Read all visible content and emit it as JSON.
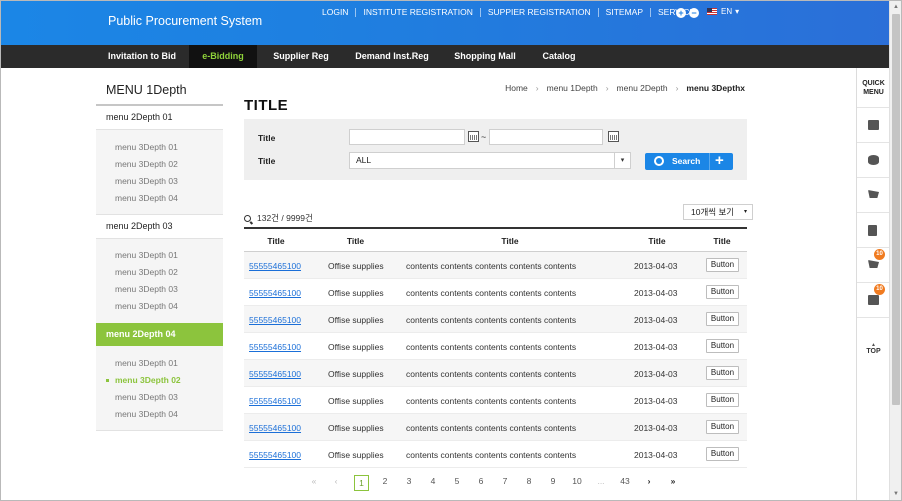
{
  "header": {
    "site_title": "Public Procurement System",
    "util_links": [
      "LOGIN",
      "INSTITUTE REGISTRATION",
      "SUPPIER REGISTRATION",
      "SITEMAP",
      "SERVICE"
    ],
    "zoom_in": "+",
    "zoom_out": "−",
    "language": "EN",
    "language_arrow": "▾"
  },
  "nav": {
    "items": [
      "Invitation to Bid",
      "e-Bidding",
      "Supplier Reg",
      "Demand Inst.Reg",
      "Shopping Mall",
      "Catalog"
    ],
    "active": "e-Bidding",
    "active_color": "#8fd33a"
  },
  "left_menu": {
    "title": "MENU 1Depth",
    "sections": [
      {
        "label": "menu 2Depth 01",
        "items": [
          "menu 3Depth 01",
          "menu 3Depth 02",
          "menu 3Depth 03",
          "menu 3Depth 04"
        ]
      },
      {
        "label": "menu 2Depth 03",
        "items": [
          "menu 3Depth 01",
          "menu 3Depth 02",
          "menu 3Depth 03",
          "menu 3Depth 04"
        ]
      },
      {
        "label": "menu 2Depth 04",
        "items": [
          "menu 3Depth 01",
          "menu 3Depth 02",
          "menu 3Depth 03",
          "menu 3Depth 04"
        ]
      }
    ],
    "active_color": "#8cc43d"
  },
  "breadcrumb": [
    "Home",
    "menu 1Depth",
    "menu 2Depth",
    "menu 3Depthx"
  ],
  "breadcrumb_sep": "›",
  "page_title": "TITLE",
  "search": {
    "label1": "Title",
    "label2": "Title",
    "date_tilde": "~",
    "select_value": "ALL",
    "select_arrow": "▾",
    "search_button": "Search",
    "add_button": "+"
  },
  "results": {
    "count_text": "132건 / 9999건",
    "per_page": "10개씩 보기",
    "per_page_arrow": "▾"
  },
  "table": {
    "headers": [
      "Title",
      "Title",
      "Title",
      "Title",
      "Title"
    ],
    "rows": [
      {
        "id": "55555465100",
        "name": "Offise supplies",
        "content": "contents contents contents contents contents",
        "date": "2013-04-03",
        "button": "Button"
      },
      {
        "id": "55555465100",
        "name": "Offise supplies",
        "content": "contents contents contents contents contents",
        "date": "2013-04-03",
        "button": "Button"
      },
      {
        "id": "55555465100",
        "name": "Offise supplies",
        "content": "contents contents contents contents contents",
        "date": "2013-04-03",
        "button": "Button"
      },
      {
        "id": "55555465100",
        "name": "Offise supplies",
        "content": "contents contents contents contents contents",
        "date": "2013-04-03",
        "button": "Button"
      },
      {
        "id": "55555465100",
        "name": "Offise supplies",
        "content": "contents contents contents contents contents",
        "date": "2013-04-03",
        "button": "Button"
      },
      {
        "id": "55555465100",
        "name": "Offise supplies",
        "content": "contents contents contents contents contents",
        "date": "2013-04-03",
        "button": "Button"
      },
      {
        "id": "55555465100",
        "name": "Offise supplies",
        "content": "contents contents contents contents contents",
        "date": "2013-04-03",
        "button": "Button"
      },
      {
        "id": "55555465100",
        "name": "Offise supplies",
        "content": "contents contents contents contents contents",
        "date": "2013-04-03",
        "button": "Button"
      }
    ]
  },
  "pagination": {
    "first": "«",
    "prev": "‹",
    "pages": [
      "1",
      "2",
      "3",
      "4",
      "5",
      "6",
      "7",
      "8",
      "9",
      "10"
    ],
    "current": "1",
    "ellipsis": "...",
    "last_page": "43",
    "next": "›",
    "last": "»"
  },
  "quick_menu": {
    "title_line1": "QUICK",
    "title_line2": "MENU",
    "icons": [
      "book-search-icon",
      "database-search-icon",
      "cart-search-icon",
      "document-search-icon",
      "cart-icon",
      "box-icon"
    ],
    "badges": [
      "10",
      "10"
    ],
    "top_arrow": "▲",
    "top_label": "TOP"
  },
  "scrollbar": {
    "up": "▲",
    "down": "▼"
  }
}
